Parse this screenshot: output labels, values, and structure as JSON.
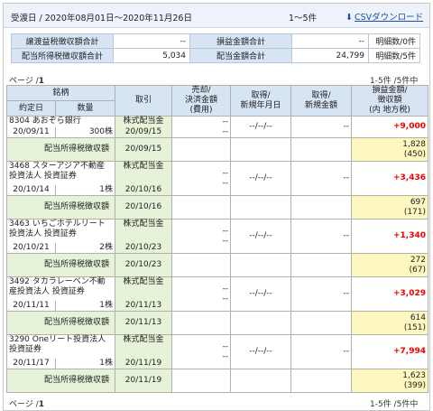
{
  "header": {
    "period": "受渡日 / 2020年08月01日～2020年11月26日",
    "count": "1～5件",
    "csv_label": "CSVダウンロード"
  },
  "summary": {
    "row1": {
      "l1": "譲渡益税徴収額合計",
      "v1": "--",
      "l2": "損益金額合計",
      "v2": "--",
      "v3": "明細数/0件"
    },
    "row2": {
      "l1": "配当所得税徴収額合計",
      "v1": "5,034",
      "l2": "配当金額合計",
      "v2": "24,799",
      "v3": "明細数/5件"
    }
  },
  "pager": {
    "page_label": "ページ /",
    "page": "1",
    "range": "1-5件 /5件中"
  },
  "columns": {
    "meigara": "銘柄",
    "torihiki": "取引",
    "baikyaku": "売却/",
    "kessai": "決済金額",
    "hiyou": "(費用)",
    "shutoku1": "取得/",
    "shinki1": "新規年月日",
    "shutoku2": "取得/",
    "shinki2": "新規金額",
    "soneki": "損益金額/",
    "choshu": "徴収額",
    "uchi": "(内 地方税)",
    "yakujo": "約定日",
    "suryo": "数量",
    "ukewatashi": "受渡日"
  },
  "rows": [
    {
      "name": "8304 あおぞら銀行",
      "yakujo": "20/09/11",
      "qty": "300株",
      "trade": "株式配当金",
      "ukewatashi": "20/09/15",
      "kessai": "--",
      "hiyou": "--",
      "shutoku_date": "--/--/--",
      "shutoku_amt": "--",
      "pl": "+9,000",
      "tax_label": "配当所得税徴収額",
      "tax_date": "20/09/15",
      "tax": "1,828",
      "tax_local": "(450)"
    },
    {
      "name": "3468 スターアジア不動産投資法人 投資証券",
      "yakujo": "20/10/14",
      "qty": "1株",
      "trade": "株式配当金",
      "ukewatashi": "20/10/16",
      "kessai": "--",
      "hiyou": "--",
      "shutoku_date": "--/--/--",
      "shutoku_amt": "--",
      "pl": "+3,436",
      "tax_label": "配当所得税徴収額",
      "tax_date": "20/10/16",
      "tax": "697",
      "tax_local": "(171)"
    },
    {
      "name": "3463 いちごホテルリート投資法人 投資証券",
      "yakujo": "20/10/21",
      "qty": "2株",
      "trade": "株式配当金",
      "ukewatashi": "20/10/23",
      "kessai": "--",
      "hiyou": "--",
      "shutoku_date": "--/--/--",
      "shutoku_amt": "--",
      "pl": "+1,340",
      "tax_label": "配当所得税徴収額",
      "tax_date": "20/10/23",
      "tax": "272",
      "tax_local": "(67)"
    },
    {
      "name": "3492 タカラレーベン不動産投資法人 投資証券",
      "yakujo": "20/11/11",
      "qty": "1株",
      "trade": "株式配当金",
      "ukewatashi": "20/11/13",
      "kessai": "--",
      "hiyou": "--",
      "shutoku_date": "--/--/--",
      "shutoku_amt": "--",
      "pl": "+3,029",
      "tax_label": "配当所得税徴収額",
      "tax_date": "20/11/13",
      "tax": "614",
      "tax_local": "(151)"
    },
    {
      "name": "3290 Oneリート投資法人 投資証券",
      "yakujo": "20/11/17",
      "qty": "1株",
      "trade": "株式配当金",
      "ukewatashi": "20/11/19",
      "kessai": "--",
      "hiyou": "--",
      "shutoku_date": "--/--/--",
      "shutoku_amt": "--",
      "pl": "+7,994",
      "tax_label": "配当所得税徴収額",
      "tax_date": "20/11/19",
      "tax": "1,623",
      "tax_local": "(399)"
    }
  ],
  "colors": {
    "header_bg": "#d7e4f4",
    "trade_bg": "#e6f3d8",
    "tax_bg": "#fdf6bf",
    "profit": "#e00000",
    "link": "#1a4fa8"
  }
}
